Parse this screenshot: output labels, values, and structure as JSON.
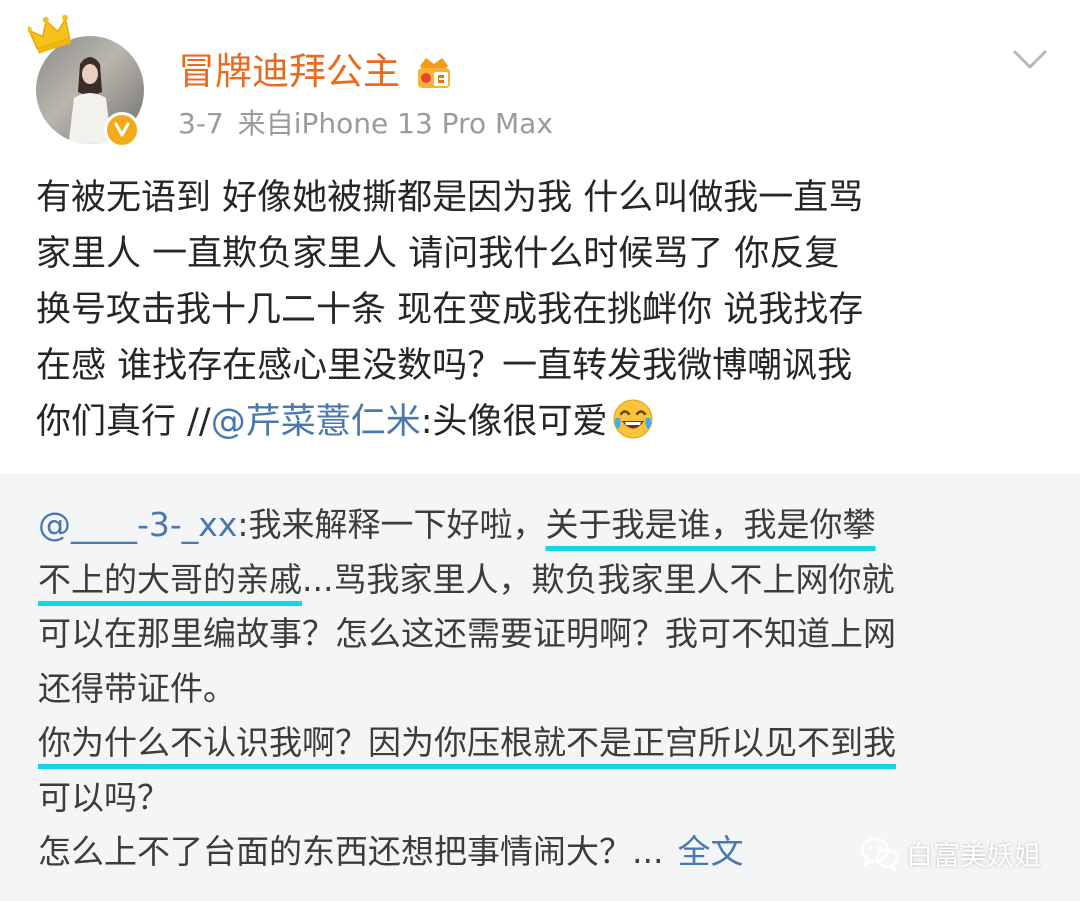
{
  "user": {
    "name": "冒牌迪拜公主",
    "date": "3-7",
    "source": "来自iPhone 13 Pro Max"
  },
  "post": {
    "lines": [
      "有被无语到  好像她被撕都是因为我 什么叫做我一直骂",
      "家里人 一直欺负家里人  请问我什么时候骂了   你反复",
      "换号攻击我十几二十条 现在变成我在挑衅你 说我找存",
      "在感 谁找存在感心里没数吗？一直转发我微博嘲讽我"
    ],
    "last_line_prefix": "你们真行 //",
    "mention": "@芹菜薏仁米",
    "last_line_suffix": ":头像很可爱"
  },
  "quote": {
    "mention": "@____-3-_xx",
    "line1_text": ":我来解释一下好啦，",
    "line1_highlight": "关于我是谁，我是你攀",
    "line2_highlight": "不上的大哥的亲戚",
    "line2_text": "...骂我家里人，欺负我家里人不上网你就",
    "line3": "可以在那里编故事？怎么这还需要证明啊？我可不知道上网",
    "line4": "还得带证件。",
    "line5_highlight": "你为什么不认识我啊？因为你压根就不是正宫所以见不到我",
    "line6": "可以吗？",
    "line7": "怎么上不了台面的东西还想把事情闹大？...",
    "fulltext_label": "全文"
  },
  "watermark": {
    "text": "白富美妖姐"
  },
  "colors": {
    "username": "#e86b1f",
    "link": "#4a78ad",
    "highlight_underline": "#14d6e4",
    "quote_bg": "#f4f5f7",
    "meta": "#9b9b9b",
    "verified": "#f4ab1b"
  },
  "icons": {
    "crown": "crown-icon",
    "verified": "verified-badge-icon",
    "member": "member-badge-icon",
    "chevron": "chevron-down-icon",
    "emoji": "laughing-tears-emoji",
    "wechat": "wechat-logo-icon"
  }
}
